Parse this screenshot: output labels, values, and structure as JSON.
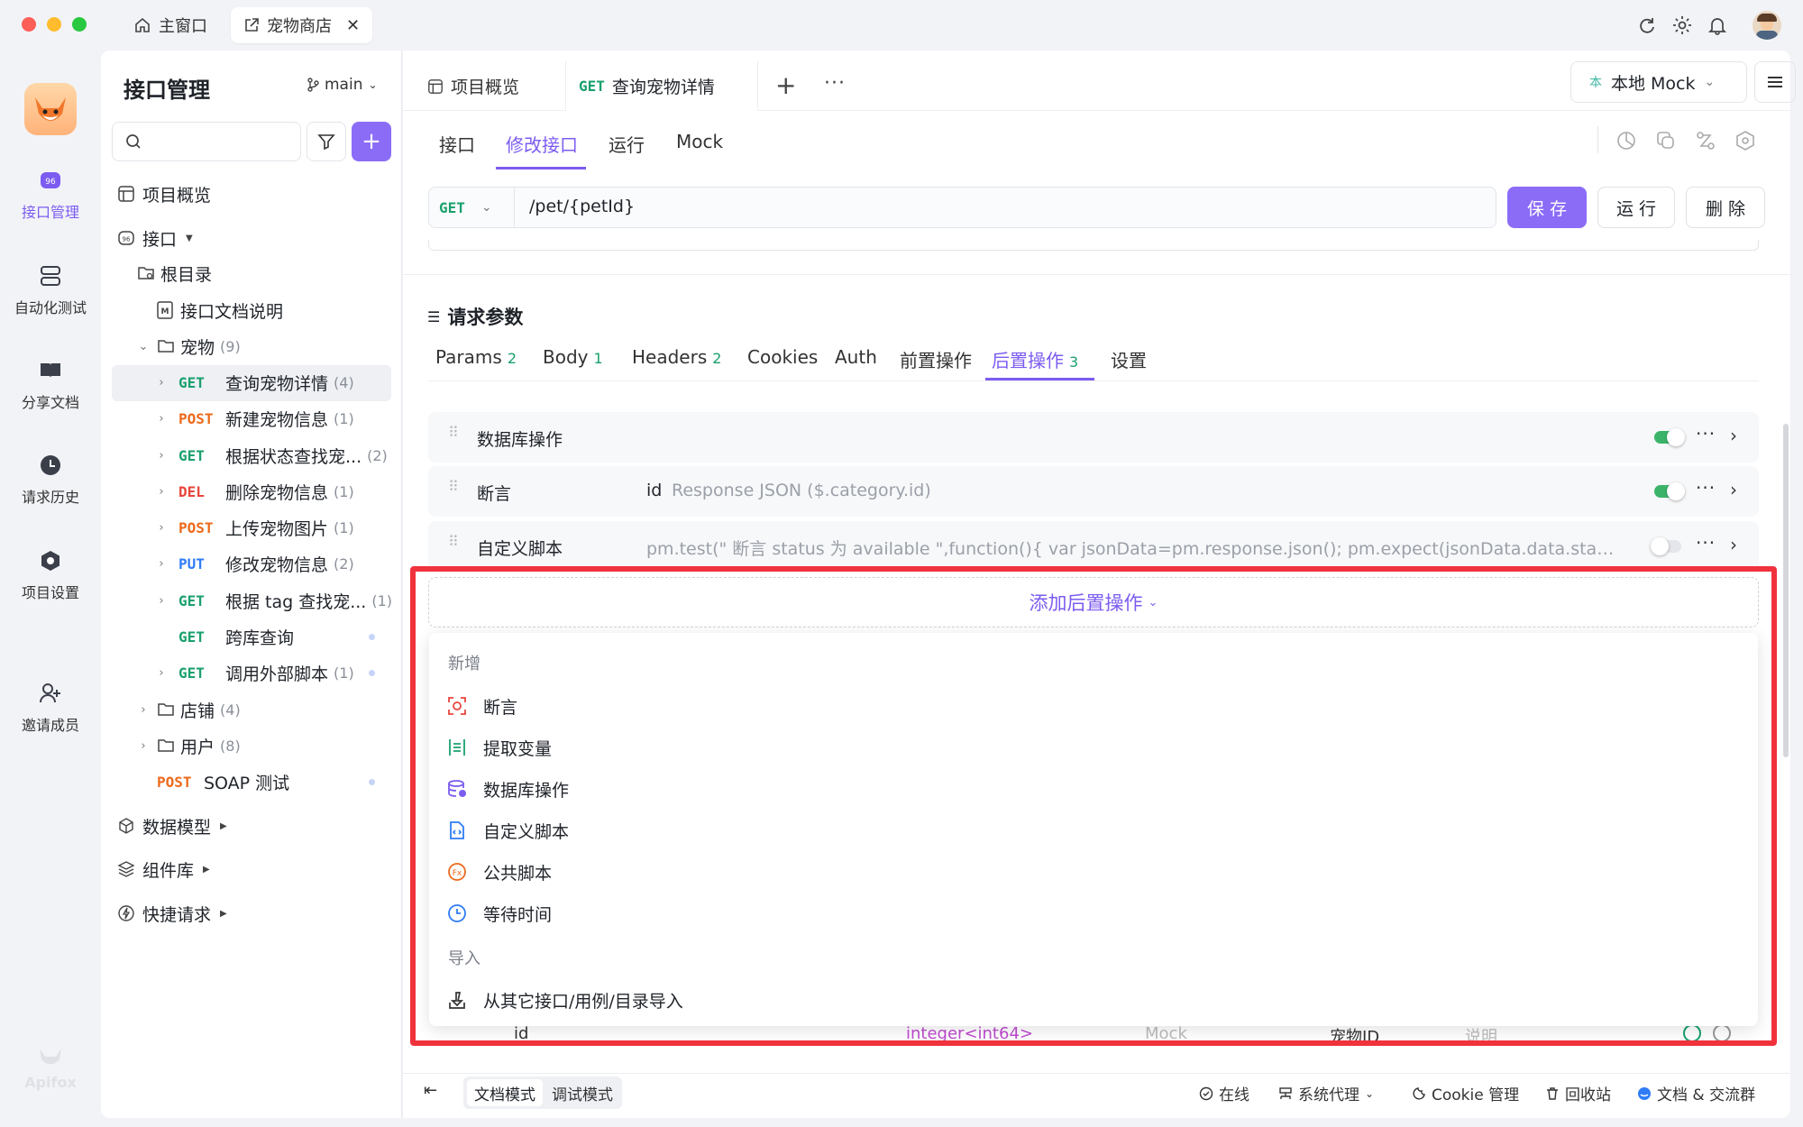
{
  "titlebar": {
    "tabs": [
      {
        "label": "主窗口",
        "icon": "home-icon"
      },
      {
        "label": "宠物商店",
        "icon": "external-link-icon"
      }
    ]
  },
  "rail": {
    "items": [
      {
        "label": "接口管理",
        "icon": "api-icon"
      },
      {
        "label": "自动化测试",
        "icon": "automation-icon"
      },
      {
        "label": "分享文档",
        "icon": "book-icon"
      },
      {
        "label": "请求历史",
        "icon": "clock-icon"
      },
      {
        "label": "项目设置",
        "icon": "settings-icon"
      },
      {
        "label": "邀请成员",
        "icon": "add-user-icon"
      }
    ],
    "brand": "Apifox"
  },
  "sidebar": {
    "title": "接口管理",
    "branch": "main",
    "search_placeholder": "",
    "overview": "项目概览",
    "api_root": "接口",
    "root_dir": "根目录",
    "doc": "接口文档说明",
    "pet_folder": {
      "name": "宠物",
      "count": "(9)"
    },
    "pet_items": [
      {
        "method": "GET",
        "name": "查询宠物详情",
        "count": "(4)"
      },
      {
        "method": "POST",
        "name": "新建宠物信息",
        "count": "(1)"
      },
      {
        "method": "GET",
        "name": "根据状态查找宠...",
        "count": "(2)"
      },
      {
        "method": "DEL",
        "name": "删除宠物信息",
        "count": "(1)"
      },
      {
        "method": "POST",
        "name": "上传宠物图片",
        "count": "(1)"
      },
      {
        "method": "PUT",
        "name": "修改宠物信息",
        "count": "(2)"
      },
      {
        "method": "GET",
        "name": "根据 tag 查找宠...",
        "count": "(1)"
      },
      {
        "method": "GET",
        "name": "跨库查询",
        "count": ""
      },
      {
        "method": "GET",
        "name": "调用外部脚本",
        "count": "(1)"
      }
    ],
    "store_folder": {
      "name": "店铺",
      "count": "(4)"
    },
    "user_folder": {
      "name": "用户",
      "count": "(8)"
    },
    "soap": {
      "method": "POST",
      "name": "SOAP 测试"
    },
    "sections": [
      "数据模型",
      "组件库",
      "快捷请求"
    ]
  },
  "main": {
    "tabs": [
      {
        "label": "项目概览"
      },
      {
        "method": "GET",
        "label": "查询宠物详情"
      }
    ],
    "env": "本地 Mock",
    "env_badge": "本",
    "subtabs": [
      "接口",
      "修改接口",
      "运行",
      "Mock"
    ],
    "request": {
      "method": "GET",
      "url": "/pet/{petId}",
      "save": "保 存",
      "run": "运 行",
      "delete": "删 除"
    },
    "section_title": "请求参数",
    "param_tabs": [
      {
        "label": "Params",
        "n": "2"
      },
      {
        "label": "Body",
        "n": "1"
      },
      {
        "label": "Headers",
        "n": "2"
      },
      {
        "label": "Cookies",
        "n": ""
      },
      {
        "label": "Auth",
        "n": ""
      },
      {
        "label": "前置操作",
        "n": ""
      },
      {
        "label": "后置操作",
        "n": "3"
      },
      {
        "label": "设置",
        "n": ""
      }
    ],
    "post_ops": [
      {
        "label": "数据库操作",
        "detail_key": "",
        "detail": "",
        "enabled": true
      },
      {
        "label": "断言",
        "detail_key": "id",
        "detail": "Response JSON ($.category.id)",
        "enabled": true
      },
      {
        "label": "自定义脚本",
        "detail_key": "",
        "detail": "pm.test(\" 断言 status 为 available \",function(){ var jsonData=pm.response.json(); pm.expect(jsonData.data.status). to.eql(...",
        "enabled": false
      }
    ],
    "add_label": "添加后置操作",
    "menu": {
      "group_new": "新增",
      "items": [
        {
          "label": "断言",
          "icon": "assertion-icon",
          "color": "#e7453d"
        },
        {
          "label": "提取变量",
          "icon": "extract-variable-icon",
          "color": "#1aa06d"
        },
        {
          "label": "数据库操作",
          "icon": "database-icon",
          "color": "#7c5cf0"
        },
        {
          "label": "自定义脚本",
          "icon": "script-icon",
          "color": "#2f7cf6"
        },
        {
          "label": "公共脚本",
          "icon": "function-icon",
          "color": "#ec6a1c"
        },
        {
          "label": "等待时间",
          "icon": "clock-icon",
          "color": "#2f7cf6"
        }
      ],
      "group_import": "导入",
      "import_item": "从其它接口/用例/目录导入"
    },
    "behind_row": {
      "name": "id",
      "type": "integer<int64>",
      "mock": "Mock",
      "title": "宠物ID",
      "desc": "说明"
    }
  },
  "statusbar": {
    "modes": [
      "文档模式",
      "调试模式"
    ],
    "items": [
      "在线",
      "系统代理",
      "Cookie 管理",
      "回收站",
      "文档 & 交流群"
    ]
  },
  "colors": {
    "accent": "#7c5cf0",
    "highlight": "#f0323c",
    "get": "#1aa06d",
    "post": "#ec6a1c"
  }
}
